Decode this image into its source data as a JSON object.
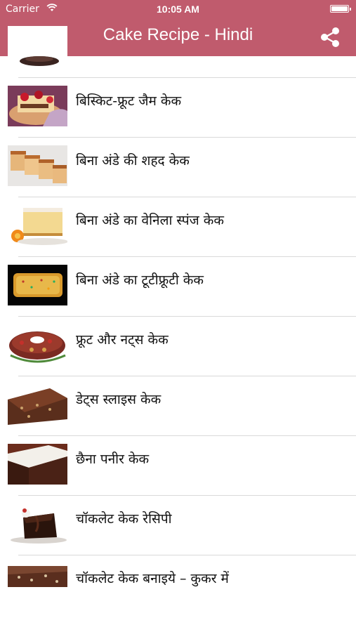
{
  "status_bar": {
    "carrier": "Carrier",
    "time": "10:05 AM",
    "battery_level": 1.0
  },
  "nav": {
    "title": "Cake Recipe - Hindi",
    "share_icon": "share-icon"
  },
  "colors": {
    "header": "#c05b6d",
    "divider": "#d9d9d9"
  },
  "recipes": [
    {
      "label": "बिस्किट-फ्रूट जैम केक"
    },
    {
      "label": "बिना अंडे की शहद केक"
    },
    {
      "label": "बिना अंडे का वेनिला स्पंज केक"
    },
    {
      "label": "बिना अंडे का टूटीफ्रूटी केक"
    },
    {
      "label": "फ्रूट और नट्स केक"
    },
    {
      "label": "डेट्स स्लाइस केक"
    },
    {
      "label": "छैना पनीर केक"
    },
    {
      "label": "चॉकलेट केक रेसिपी"
    },
    {
      "label": "चॉकलेट केक बनाइये – कुकर में"
    }
  ]
}
